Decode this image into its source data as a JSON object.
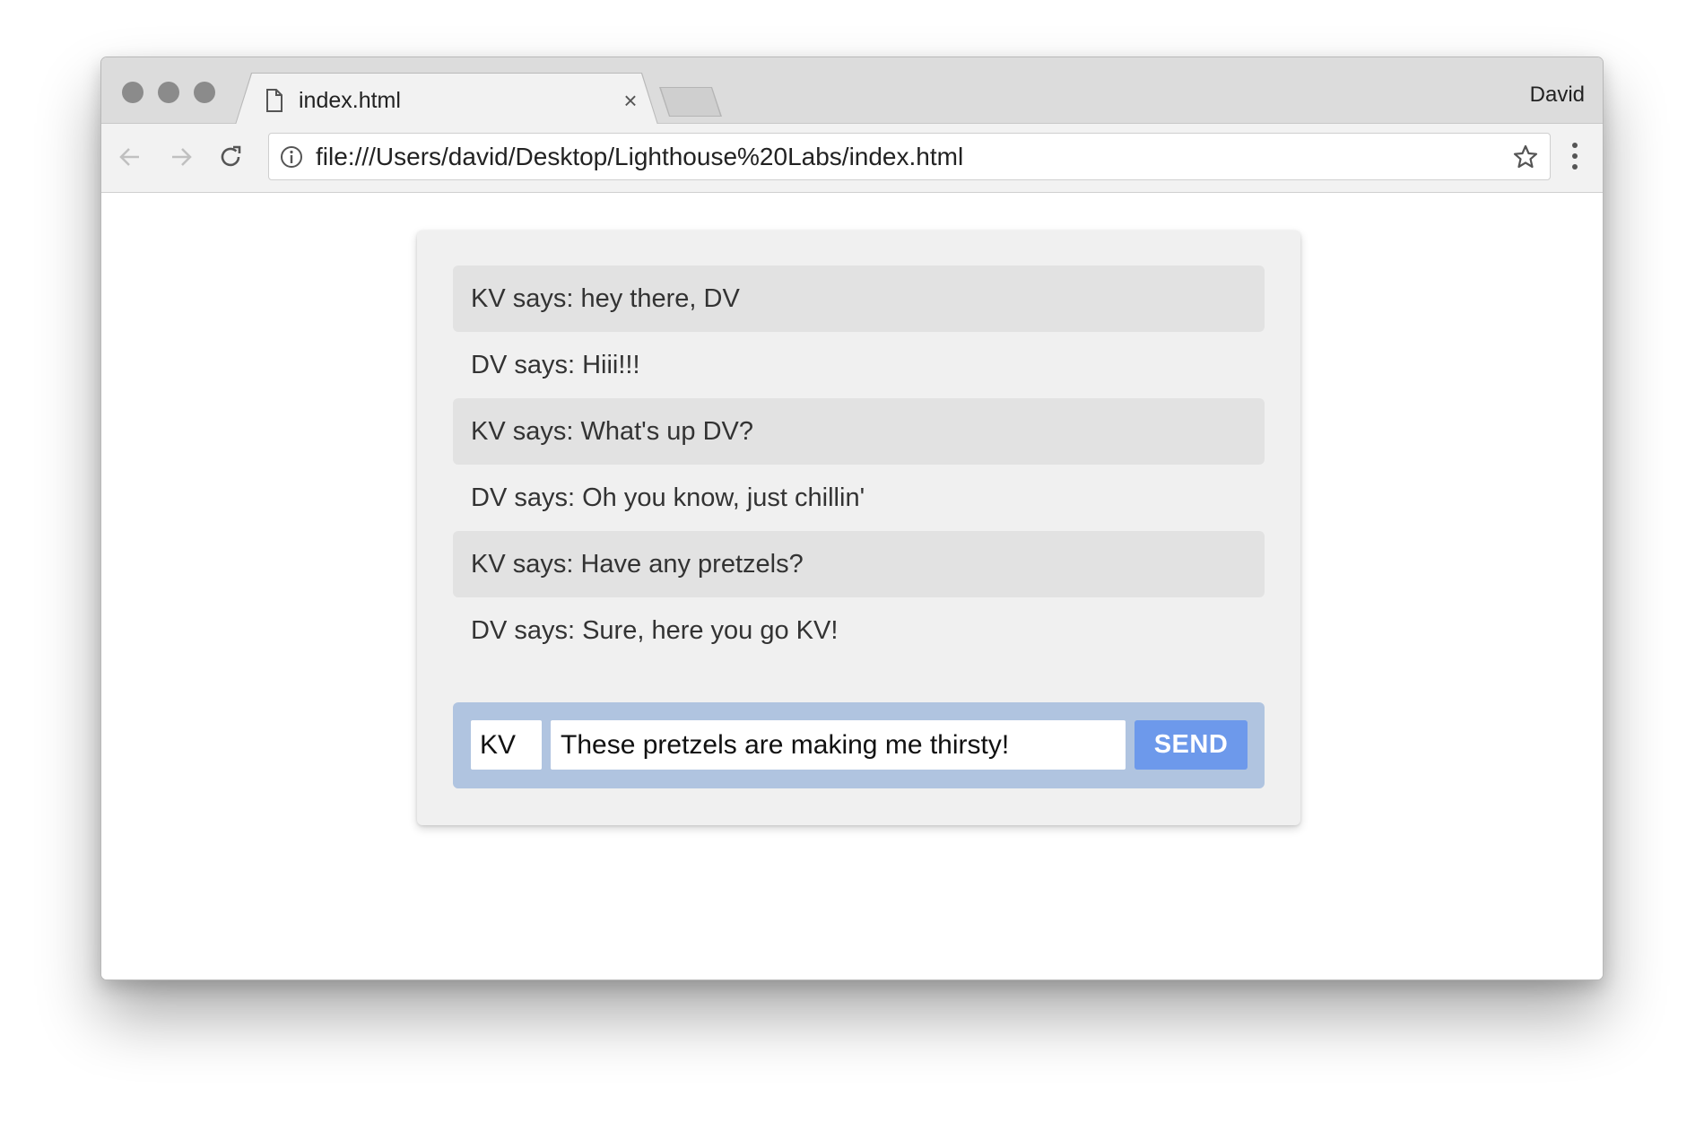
{
  "browser": {
    "tab": {
      "title": "index.html",
      "close_glyph": "×"
    },
    "profile_name": "David",
    "address_bar": {
      "url": "file:///Users/david/Desktop/Lighthouse%20Labs/index.html"
    }
  },
  "chat": {
    "messages": [
      {
        "text": "KV says: hey there, DV",
        "highlighted": true
      },
      {
        "text": "DV says: Hiii!!!",
        "highlighted": false
      },
      {
        "text": "KV says: What's up DV?",
        "highlighted": true
      },
      {
        "text": "DV says: Oh you know, just chillin'",
        "highlighted": false
      },
      {
        "text": "KV says: Have any pretzels?",
        "highlighted": true
      },
      {
        "text": "DV says: Sure, here you go KV!",
        "highlighted": false
      }
    ],
    "composer": {
      "name_value": "KV",
      "message_value": "These pretzels are making me thirsty!",
      "send_label": "SEND"
    }
  },
  "colors": {
    "send_button": "#6d99eb",
    "composer_background": "#b0c4e0",
    "card_background": "#f0f0f0",
    "highlighted_message": "#e2e2e2"
  }
}
